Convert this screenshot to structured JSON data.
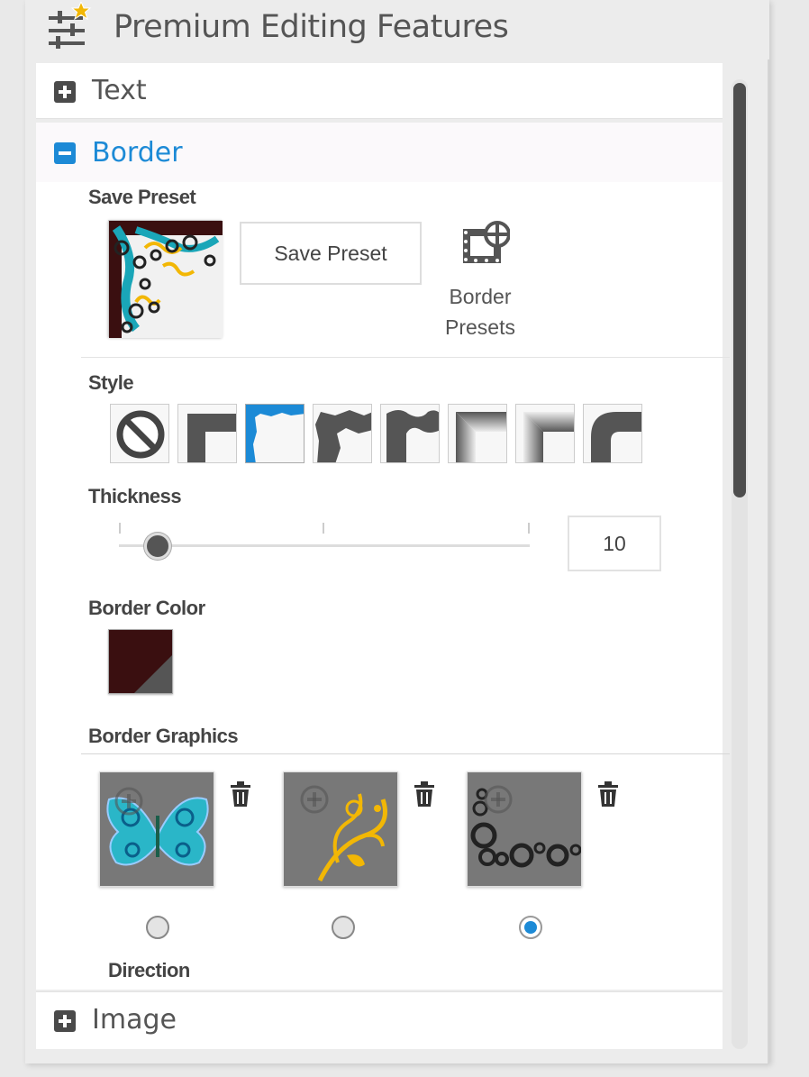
{
  "panel": {
    "title": "Premium Editing Features"
  },
  "sections": {
    "text": {
      "label": "Text",
      "state": "collapsed"
    },
    "border": {
      "label": "Border",
      "state": "expanded"
    },
    "image": {
      "label": "Image",
      "state": "collapsed"
    }
  },
  "border": {
    "save_preset_heading": "Save Preset",
    "save_preset_button": "Save Preset",
    "border_presets_line1": "Border",
    "border_presets_line2": "Presets",
    "style_heading": "Style",
    "style_options": [
      "none",
      "square-thick",
      "rough-blue",
      "rough",
      "wavy",
      "gradient-bevel",
      "gradient-inset",
      "rounded"
    ],
    "selected_style_index": 2,
    "thickness_heading": "Thickness",
    "thickness_value": "10",
    "thickness_fraction": 0.09,
    "border_color_heading": "Border Color",
    "border_color": "#3a0f10",
    "border_graphics_heading": "Border Graphics",
    "graphics": [
      {
        "name": "butterfly",
        "selected": false
      },
      {
        "name": "swirl-flourish",
        "selected": false
      },
      {
        "name": "circles",
        "selected": true
      }
    ],
    "direction_heading": "Direction"
  },
  "colors": {
    "accent": "#1c8ad6",
    "icon_star": "#f2b705"
  }
}
